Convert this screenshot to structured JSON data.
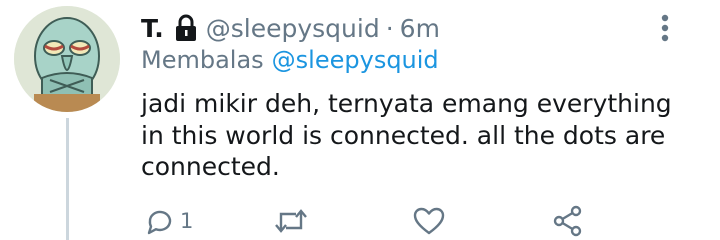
{
  "tweet": {
    "display_name": "T.",
    "handle": "@sleepysquid",
    "separator": "·",
    "time": "6m",
    "reply_prefix": "Membalas",
    "reply_mention": "@sleepysquid",
    "text": "jadi mikir deh, ternyata emang everything in this world is connected. all the dots are connected."
  },
  "actions": {
    "reply_count": "1"
  },
  "icons": {
    "protected": "lock-icon",
    "more": "more-vertical-icon",
    "reply": "comment-icon",
    "retweet": "retweet-icon",
    "like": "heart-icon",
    "share": "share-icon"
  },
  "colors": {
    "text": "#14171a",
    "secondary": "#657786",
    "link": "#1b95e0",
    "divider": "#ccd6dd"
  }
}
